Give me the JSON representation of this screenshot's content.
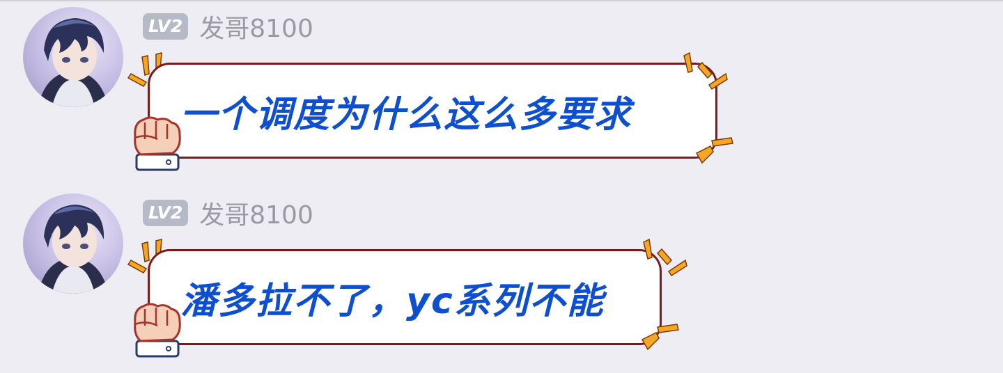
{
  "colors": {
    "background": "#ededf3",
    "badge": "#b6bac6",
    "username": "#9a9aa2",
    "bubble_text": "#0e4fd0",
    "bubble_border": "#7a1a1a",
    "spark": "#f5a623"
  },
  "messages": [
    {
      "badge": "LV2",
      "username": "发哥8100",
      "text": "一个调度为什么这么多要求"
    },
    {
      "badge": "LV2",
      "username": "发哥8100",
      "text": "潘多拉不了，yc系列不能"
    }
  ]
}
